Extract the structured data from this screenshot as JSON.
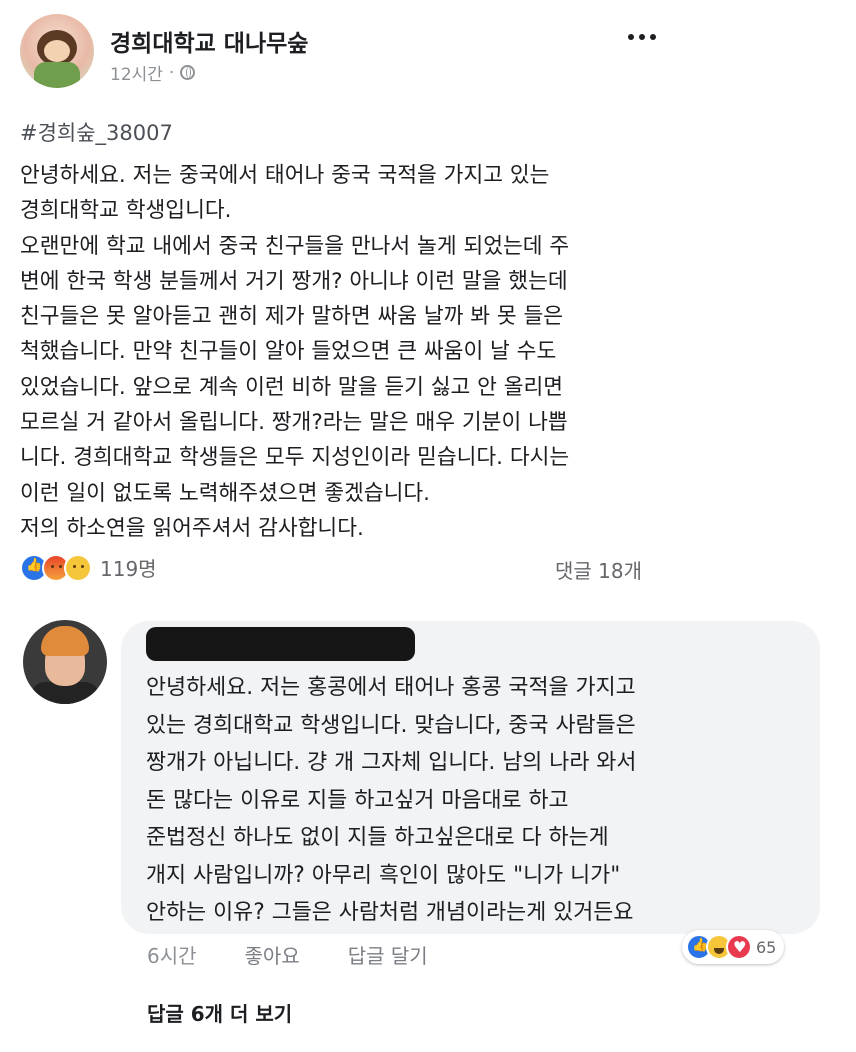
{
  "post": {
    "page_name": "경희대학교 대나무숲",
    "time": "12시간",
    "separator": "·",
    "hashtag": "#경희숲_38007",
    "body_lines": [
      "안녕하세요. 저는 중국에서 태어나 중국 국적을 가지고 있는",
      "경희대학교 학생입니다.",
      "오랜만에 학교 내에서 중국 친구들을 만나서 놀게 되었는데 주",
      "변에 한국 학생 분들께서 거기 짱개? 아니냐 이런 말을 했는데",
      "친구들은 못 알아듣고 괜히 제가 말하면 싸움 날까 봐 못 들은",
      "척했습니다. 만약 친구들이 알아 들었으면 큰 싸움이 날 수도",
      "있었습니다. 앞으로 계속 이런 비하 말을 듣기 싫고 안 올리면",
      "모르실 거 같아서 올립니다. 짱개?라는 말은 매우 기분이 나쁩",
      "니다. 경희대학교 학생들은 모두 지성인이라 믿습니다. 다시는",
      "이런 일이 없도록 노력해주셨으면 좋겠습니다.",
      "저의 하소연을 읽어주셔서 감사합니다."
    ],
    "reactions_count": "119명",
    "comments_count": "댓글 18개"
  },
  "comment": {
    "text_lines": [
      "안녕하세요. 저는 홍콩에서 태어나 홍콩 국적을 가지고",
      "있는 경희대학교 학생입니다. 맞습니다, 중국 사람들은",
      "짱개가 아닙니다. 걍 개 그자체 입니다. 남의 나라 와서",
      "돈 많다는 이유로 지들 하고싶거 마음대로 하고",
      "준법정신 하나도 없이 지들 하고싶은대로 다 하는게",
      "개지 사람입니까? 아무리 흑인이 많아도 \"니가 니가\"",
      "안하는 이유? 그들은 사람처럼 개념이라는게 있거든요"
    ],
    "time": "6시간",
    "like_label": "좋아요",
    "reply_label": "답글 달기",
    "reactions_count": "65",
    "more_replies": "답글 6개 더 보기"
  },
  "colors": {
    "like": "#2a74e8",
    "love": "#e83b50",
    "muted": "#8d9196"
  }
}
